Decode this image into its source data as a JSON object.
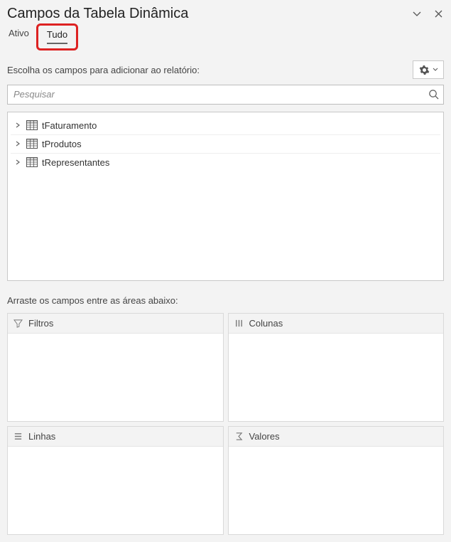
{
  "header": {
    "title": "Campos da Tabela Dinâmica"
  },
  "tabs": {
    "active_label": "Ativo",
    "all_label": "Tudo",
    "selected": "all"
  },
  "instruct": "Escolha os campos para adicionar ao relatório:",
  "search": {
    "placeholder": "Pesquisar"
  },
  "field_list": [
    {
      "name": "tFaturamento"
    },
    {
      "name": "tProdutos"
    },
    {
      "name": "tRepresentantes"
    }
  ],
  "drag_instruct": "Arraste os campos entre as áreas abaixo:",
  "zones": {
    "filters": "Filtros",
    "columns": "Colunas",
    "rows": "Linhas",
    "values": "Valores"
  }
}
